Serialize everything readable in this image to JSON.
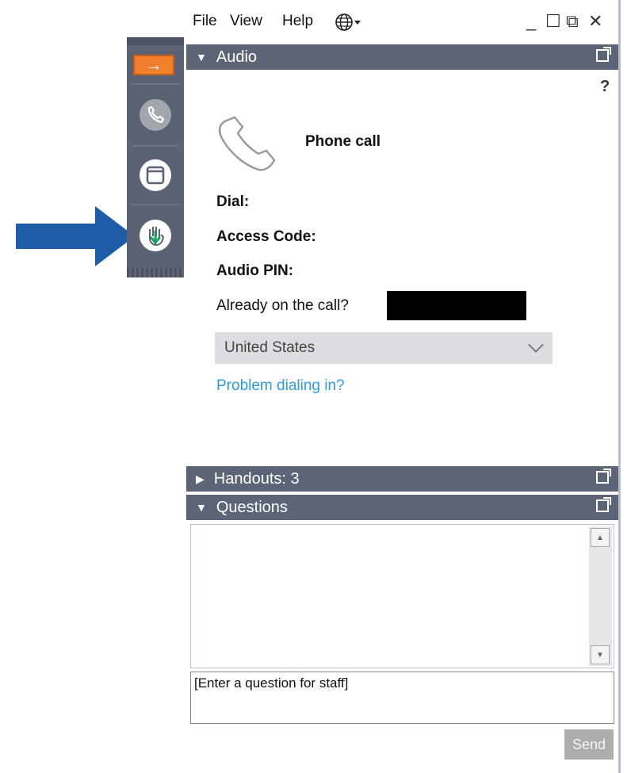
{
  "menu": {
    "file": "File",
    "view": "View",
    "help": "Help"
  },
  "window_controls": {
    "minimize": "_",
    "maximize": "☐",
    "restore": "⧉",
    "close": "✕"
  },
  "sidebar": {
    "items": [
      {
        "icon": "arrow-right-icon",
        "glyph": "→"
      },
      {
        "icon": "phone-icon"
      },
      {
        "icon": "window-icon"
      },
      {
        "icon": "raise-hand-icon"
      }
    ]
  },
  "audio_panel": {
    "title": "Audio",
    "help": "?",
    "mode_label": "Phone call",
    "dial_label": "Dial:",
    "access_code_label": "Access Code:",
    "audio_pin_label": "Audio PIN:",
    "already_on_call": "Already on the call?",
    "country": "United States",
    "problem_link": "Problem dialing in?"
  },
  "handouts_panel": {
    "title": "Handouts: 3"
  },
  "questions_panel": {
    "title": "Questions",
    "input_value": "[Enter a question for staff]",
    "send_label": "Send"
  },
  "colors": {
    "panel_header": "#5d6475",
    "sidebar": "#5b6273",
    "accent_orange": "#f27f2d",
    "link_blue": "#2e9bd6",
    "annotation_arrow": "#1f5ca8"
  }
}
